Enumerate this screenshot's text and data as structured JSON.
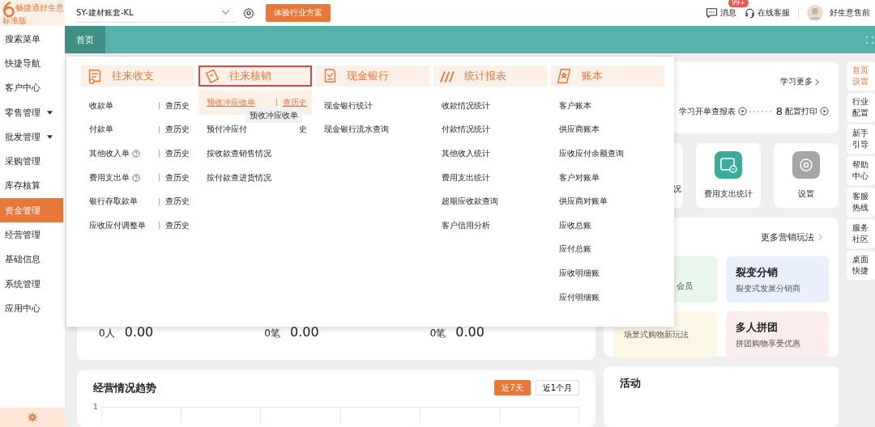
{
  "logo": {
    "name": "畅捷通好生意",
    "edition": "标准版"
  },
  "topbar": {
    "account": "SY-建材账套-KL",
    "promo_button": "体验行业方案",
    "messages": {
      "label": "消息",
      "badge": "99+"
    },
    "support": "在线客服",
    "user": "好生意售前"
  },
  "sidebar": {
    "items": [
      {
        "label": "搜索菜单",
        "selected": false,
        "has_submenu": false
      },
      {
        "label": "快捷导航",
        "selected": false,
        "has_submenu": false
      },
      {
        "label": "客户中心",
        "selected": false,
        "has_submenu": false
      },
      {
        "label": "零售管理",
        "selected": false,
        "has_submenu": true
      },
      {
        "label": "批发管理",
        "selected": false,
        "has_submenu": true
      },
      {
        "label": "采购管理",
        "selected": false,
        "has_submenu": false
      },
      {
        "label": "库存核算",
        "selected": false,
        "has_submenu": false
      },
      {
        "label": "资金管理",
        "selected": true,
        "has_submenu": false
      },
      {
        "label": "经营管理",
        "selected": false,
        "has_submenu": false
      },
      {
        "label": "基础信息",
        "selected": false,
        "has_submenu": false
      },
      {
        "label": "系统管理",
        "selected": false,
        "has_submenu": false
      },
      {
        "label": "应用中心",
        "selected": false,
        "has_submenu": false
      }
    ]
  },
  "tabs": [
    {
      "label": "首页",
      "selected": true
    }
  ],
  "menu": {
    "tooltip": "预收冲应收单",
    "columns": [
      {
        "title": "往来收支",
        "selected": false,
        "items": [
          {
            "label": "收款单",
            "history": "查历史",
            "help": false,
            "highlighted": false
          },
          {
            "label": "付款单",
            "history": "查历史",
            "help": false,
            "highlighted": false
          },
          {
            "label": "其他收入单",
            "history": "查历史",
            "help": true,
            "highlighted": false
          },
          {
            "label": "费用支出单",
            "history": "查历史",
            "help": true,
            "highlighted": false
          },
          {
            "label": "银行存取款单",
            "history": "查历史",
            "help": false,
            "highlighted": false
          },
          {
            "label": "应收应付调整单",
            "history": "查历史",
            "help": false,
            "highlighted": false
          }
        ]
      },
      {
        "title": "往来核销",
        "selected": true,
        "items": [
          {
            "label": "预收冲应收单",
            "history": "查历史",
            "help": false,
            "highlighted": true
          },
          {
            "label": "预付冲应付",
            "history": "史",
            "help": false,
            "highlighted": false,
            "tooltip": true
          },
          {
            "label": "按收款查销售情况",
            "help": false,
            "highlighted": false
          },
          {
            "label": "按付款查进货情况",
            "help": false,
            "highlighted": false
          }
        ]
      },
      {
        "title": "现金银行",
        "selected": false,
        "items": [
          {
            "label": "现金银行统计",
            "help": false,
            "highlighted": false
          },
          {
            "label": "现金银行流水查询",
            "help": false,
            "highlighted": false
          }
        ]
      },
      {
        "title": "统计报表",
        "selected": false,
        "items": [
          {
            "label": "收款情况统计",
            "help": false,
            "highlighted": false
          },
          {
            "label": "付款情况统计",
            "help": false,
            "highlighted": false
          },
          {
            "label": "其他收入统计",
            "help": false,
            "highlighted": false
          },
          {
            "label": "费用支出统计",
            "help": false,
            "highlighted": false
          },
          {
            "label": "超期应收款查询",
            "help": false,
            "highlighted": false
          },
          {
            "label": "客户信用分析",
            "help": false,
            "highlighted": false
          }
        ]
      },
      {
        "title": "账本",
        "selected": false,
        "items": [
          {
            "label": "客户账本",
            "help": false,
            "highlighted": false
          },
          {
            "label": "供应商账本",
            "help": false,
            "highlighted": false
          },
          {
            "label": "应收应付余额查询",
            "help": false,
            "highlighted": false
          },
          {
            "label": "客户对账单",
            "help": false,
            "highlighted": false
          },
          {
            "label": "供应商对账单",
            "help": false,
            "highlighted": false
          },
          {
            "label": "应收总账",
            "help": false,
            "highlighted": false
          },
          {
            "label": "应付总账",
            "help": false,
            "highlighted": false
          },
          {
            "label": "应收明细账",
            "help": false,
            "highlighted": false
          },
          {
            "label": "应付明细账",
            "help": false,
            "highlighted": false
          }
        ]
      }
    ]
  },
  "stats": [
    {
      "count": "0人",
      "amount": "0.00"
    },
    {
      "count": "0笔",
      "amount": "0.00"
    },
    {
      "count": "0笔",
      "amount": "0.00"
    }
  ],
  "trend": {
    "title": "经营情况趋势",
    "ranges": [
      {
        "label": "近7天",
        "selected": true
      },
      {
        "label": "近1个月",
        "selected": false
      }
    ],
    "y_tick": "1"
  },
  "guide": {
    "learn_more": "学习更多",
    "steps": [
      {
        "label": "学习开单查报表"
      },
      {
        "number": "8",
        "label": "配置打印"
      }
    ]
  },
  "tiles": [
    {
      "kind": "partial",
      "label": "况"
    },
    {
      "kind": "money",
      "label": "费用支出统计"
    },
    {
      "kind": "settings",
      "label": "设置"
    }
  ],
  "marketing": {
    "more": "更多营销玩法",
    "cards": [
      {
        "kind": "partial",
        "subtitle": "会员",
        "color": "#e8f6ec"
      },
      {
        "kind": "full",
        "title": "裂变分销",
        "subtitle": "裂变式发展分销商",
        "color": "#e9effc"
      },
      {
        "kind": "full",
        "subtitle": "场景式购物新玩法",
        "color": "#fdf8e6"
      },
      {
        "kind": "full",
        "title": "多人拼团",
        "subtitle": "拼团购物享受优惠",
        "color": "#fcecec"
      }
    ]
  },
  "activity": {
    "title": "活动"
  },
  "right_nav": [
    {
      "label": "首页设置",
      "selected": true
    },
    {
      "label": "行业配置",
      "selected": false
    },
    {
      "label": "新手引导",
      "selected": false
    },
    {
      "label": "帮助中心",
      "selected": false
    },
    {
      "label": "客服热线",
      "selected": false
    },
    {
      "label": "服务社区",
      "selected": false
    },
    {
      "label": "桌面快捷",
      "selected": false
    }
  ]
}
